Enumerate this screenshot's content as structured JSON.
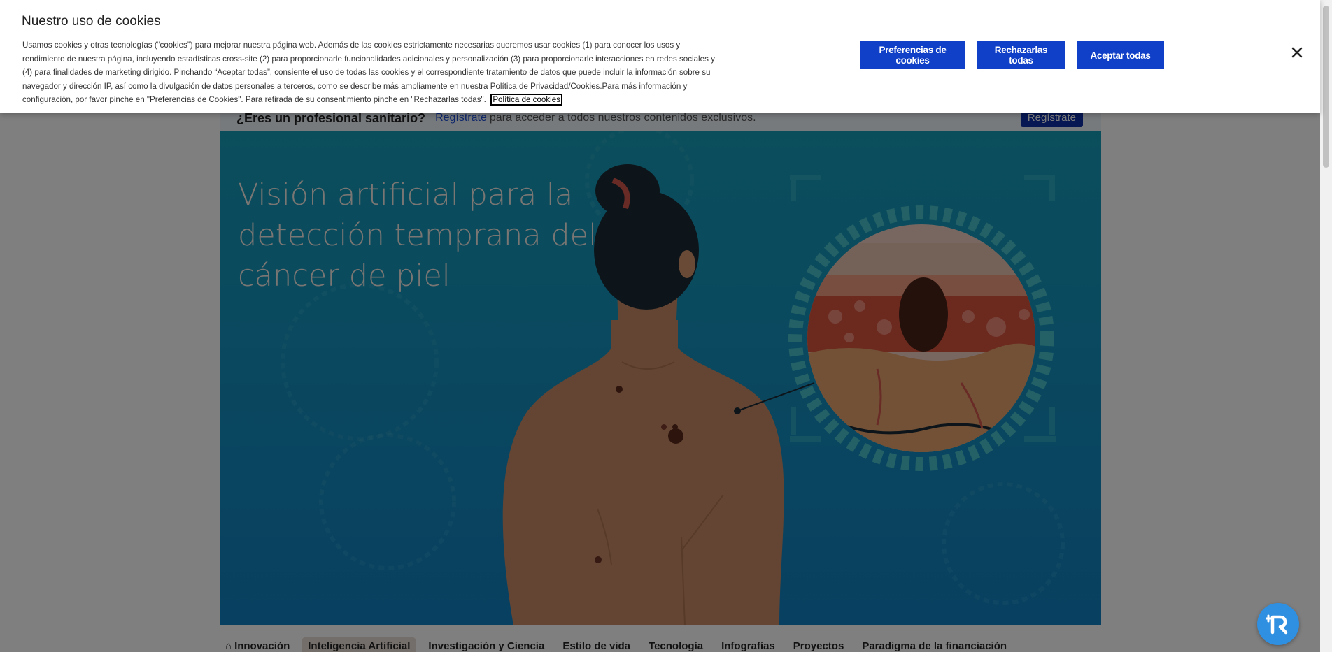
{
  "cookie_banner": {
    "title": "Nuestro uso de cookies",
    "description": "Usamos cookies y otras tecnologías (“cookies”) para mejorar nuestra página web. Además de las cookies estrictamente necesarias queremos usar cookies (1) para conocer los usos y rendimiento de nuestra página, incluyendo estadísticas cross-site (2) para proporcionarle funcionalidades adicionales y personalización (3) para proporcionarle interacciones en redes sociales y (4) para finalidades de marketing dirigido. Pinchando “Aceptar todas”, consiente el uso de todas las cookies y el correspondiente tratamiento de datos que puede incluir la información sobre su navegador y dirección IP, así como la divulgación de datos personales a terceros, como se describe más ampliamente en nuestra Política de Privacidad/Cookies.Para más información y configuración, por favor pinche en \"Preferencias de Cookies\". Para retirada de su consentimiento pinche en \"Rechazarlas todas\".",
    "policy_link": "Política de cookies",
    "preferences_label": "Preferencias de cookies",
    "reject_label": "Rechazarlas todas",
    "accept_label": "Aceptar todas",
    "close_icon": "close-icon"
  },
  "register_bar": {
    "question": "¿Eres un profesional sanitario?",
    "link": "Regístrate",
    "rest": "para acceder a todos nuestros contenidos exclusivos.",
    "button_label": "Regístrate"
  },
  "hero": {
    "title": "Visión artificial para la detección temprana del cáncer de piel"
  },
  "subnav": {
    "items": [
      {
        "label": "Innovación",
        "icon": "home-icon"
      },
      {
        "label": "Inteligencia Artificial",
        "active": true
      },
      {
        "label": "Investigación y Ciencia"
      },
      {
        "label": "Estilo de vida"
      },
      {
        "label": "Tecnología"
      },
      {
        "label": "Infografías"
      },
      {
        "label": "Proyectos"
      },
      {
        "label": "Paradigma de la financiación"
      }
    ]
  },
  "floating_button": {
    "icon": "assistant-r-icon"
  },
  "colors": {
    "primary_button": "#1040c8",
    "hero_teal": "#169cb7",
    "hero_blue": "#1180c2",
    "skin": "#c98a67"
  }
}
